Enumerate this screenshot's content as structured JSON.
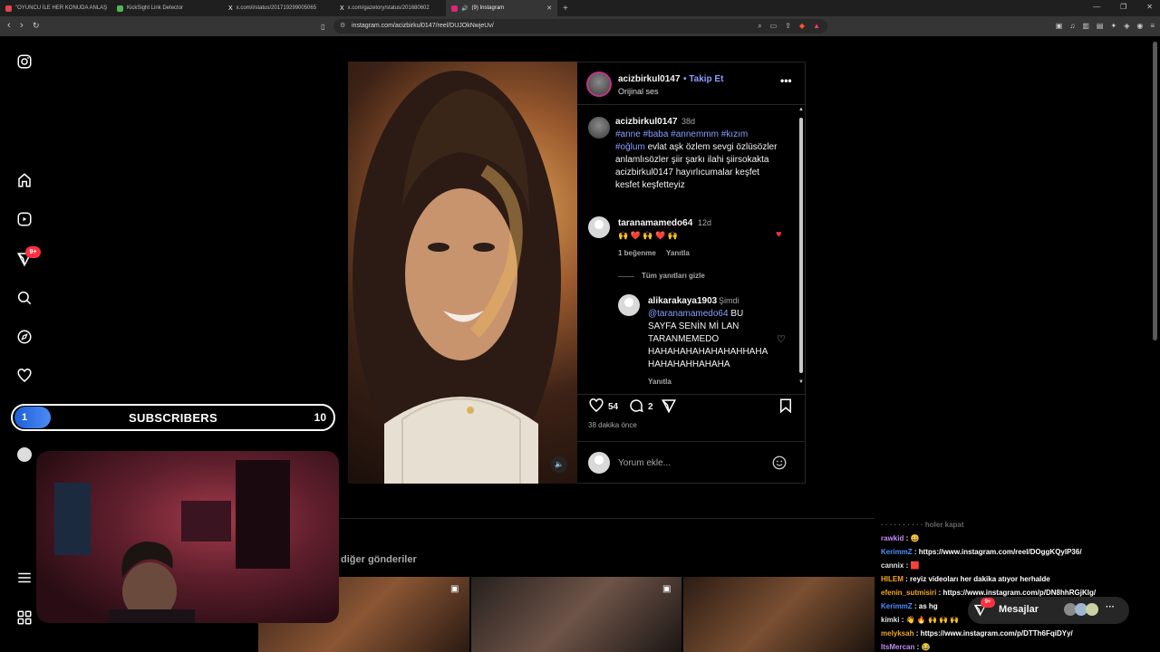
{
  "browser": {
    "tabs": [
      {
        "title": "\"OYUNCU İLE HER KONUDA ANLAŞ",
        "fav_color": "#e0474c"
      },
      {
        "title": "KickSight Link Detector",
        "fav_color": "#53b35a"
      },
      {
        "title": "x.com/i/status/201719299005065",
        "fav_color": "#ffffff"
      },
      {
        "title": "x.com/gazetory/status/201680602",
        "fav_color": "#ffffff"
      },
      {
        "title": "(9) Instagram",
        "fav_color": "#d62976"
      }
    ],
    "active_tab": 4,
    "url": "instagram.com/acizbirkul0147/reel/DUJOkNwjeUv/"
  },
  "subscribers": {
    "current": "1",
    "label": "SUBSCRIBERS",
    "goal": "10"
  },
  "sidebar": {
    "notification_badge": "9+"
  },
  "post": {
    "username": "acizbirkul0147",
    "follow": "• Takip Et",
    "audio": "Orijinal ses",
    "caption_user": "acizbirkul0147",
    "caption_time": "38d",
    "caption_tags": "#anne #baba #annemmm #kızım",
    "caption_tag2": "#oğlum",
    "caption_rest1": " evlat aşk özlem sevgi özlüsözler",
    "caption_rest2": "anlamlısözler şiir şarkı ilahi şiirsokakta",
    "caption_rest3": "acizbirkul0147 hayırlıcumalar keşfet",
    "caption_rest4": "kesfet keşfetteyiz",
    "comment1_user": "taranamamedo64",
    "comment1_time": "12d",
    "comment1_text": "🙌 ❤️ 🙌 ❤️ 🙌",
    "comment1_likes": "1 beğenme",
    "reply_label": "Yanıtla",
    "hide_replies": "Tüm yanıtları gizle",
    "reply_user": "alikarakaya1903",
    "reply_time": "Şimdi",
    "reply_mention": "@taranamamedo64",
    "reply_line1": " BU",
    "reply_line2": "SAYFA SENİN Mİ LAN",
    "reply_line3": "TARANMEMEDO",
    "reply_line4": "HAHAHAHAHAHAHAHHAHA",
    "reply_line5": "HAHAHAHHAHAHA",
    "reply_reply": "Yanıtla",
    "likes_count": "54",
    "comments_count": "2",
    "time_ago": "38 dakika önce",
    "comment_placeholder": "Yorum ekle..."
  },
  "other_posts_label": "diğer gönderiler",
  "messages_label": "Mesajlar",
  "messages_badge": "9+",
  "chat": [
    {
      "user": "",
      "text": "· · · · · · · · · · holer kapat",
      "color": "#777777"
    },
    {
      "user": "rawkid",
      "text": " : 😀",
      "color": "#c58af9"
    },
    {
      "user": "KerimmZ",
      "text": " : https://www.instagram.com/reel/DOggKQylP36/",
      "color": "#4f8cff"
    },
    {
      "user": "cannix",
      "text": " : 🟥",
      "color": "#e0e0e0"
    },
    {
      "user": "HILEM",
      "text": " : reyiz videoları her dakika atıyor herhalde",
      "color": "#f5a623"
    },
    {
      "user": "efenin_sutmisiri",
      "text": " : https://www.instagram.com/p/DN8hhRGjKIg/",
      "color": "#f5a623"
    },
    {
      "user": "KerimmZ",
      "text": " : as hg",
      "color": "#4f8cff"
    },
    {
      "user": "kimki",
      "text": " : 👋 🔥 🙌 🙌 🙌",
      "color": "#e0e0e0"
    },
    {
      "user": "melyksah",
      "text": " : https://www.instagram.com/p/DTTh6FqiDYy/",
      "color": "#f5a623"
    },
    {
      "user": "ItsMercan",
      "text": " : 😂",
      "color": "#c58af9"
    }
  ]
}
